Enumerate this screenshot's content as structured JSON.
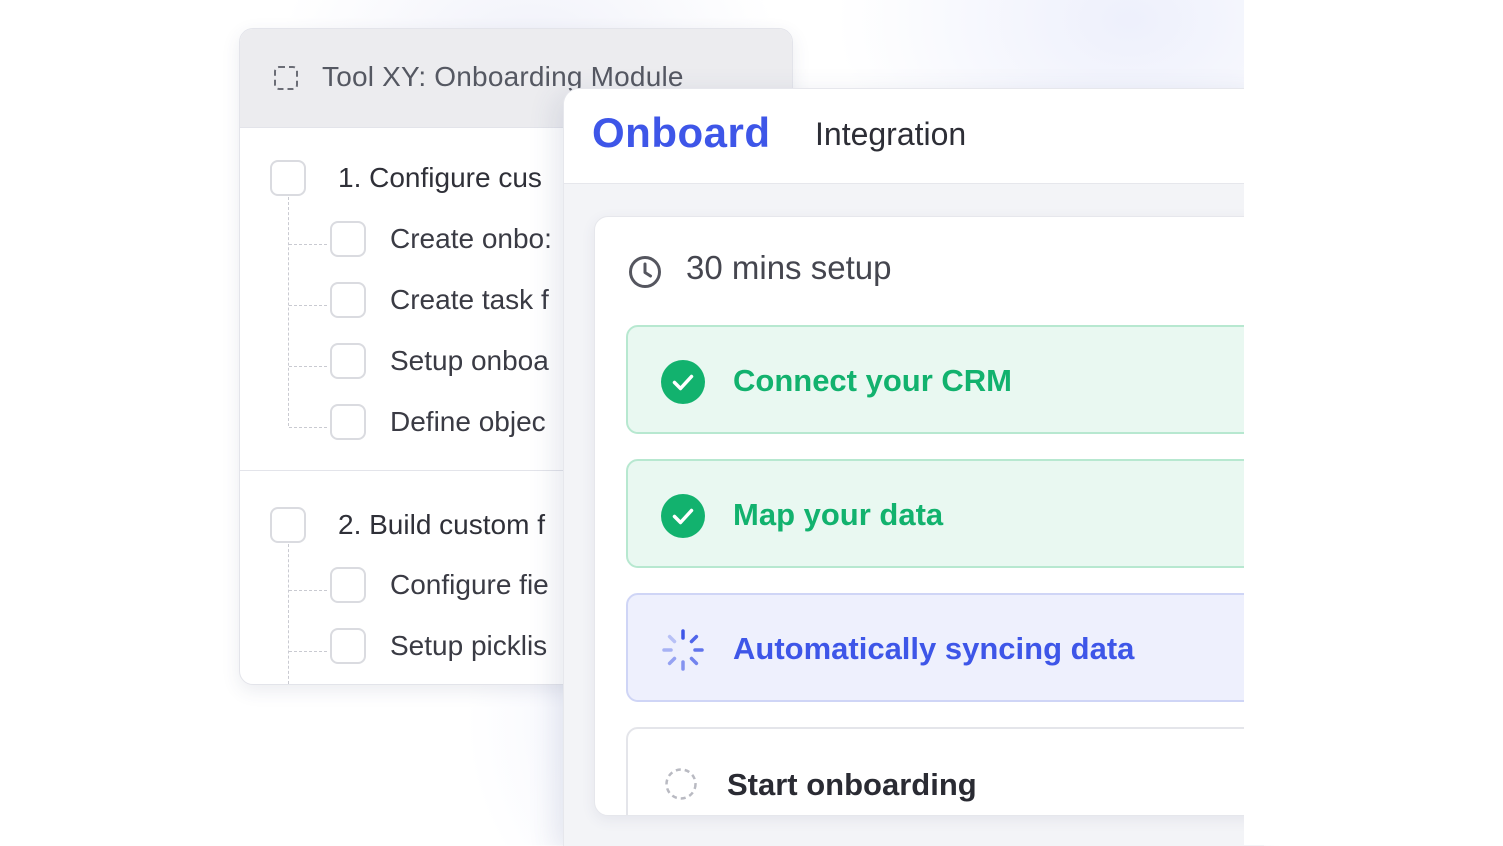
{
  "back_card": {
    "title": "Tool XY: Onboarding Module",
    "tasks": [
      {
        "label": "1. Configure cus",
        "subtasks": [
          "Create onbo:",
          "Create task f",
          "Setup onboa",
          "Define objec"
        ]
      },
      {
        "label": "2. Build custom f",
        "subtasks": [
          "Configure fie",
          "Setup picklis"
        ]
      }
    ]
  },
  "front_panel": {
    "brand": "Onboard",
    "title": "Integration",
    "setup_time": "30 mins setup",
    "steps": [
      {
        "label": "Connect your CRM",
        "status": "done",
        "icon": "check-circle-icon"
      },
      {
        "label": "Map your data",
        "status": "done",
        "icon": "check-circle-icon"
      },
      {
        "label": "Automatically syncing data",
        "status": "in-progress",
        "icon": "spinner-icon"
      },
      {
        "label": "Start onboarding",
        "status": "pending",
        "icon": "dashed-circle-icon"
      }
    ]
  },
  "colors": {
    "brand_blue": "#3e56e8",
    "success_green": "#12b26e",
    "success_bg": "#e9f8f1",
    "active_bg": "#eef0fd"
  }
}
